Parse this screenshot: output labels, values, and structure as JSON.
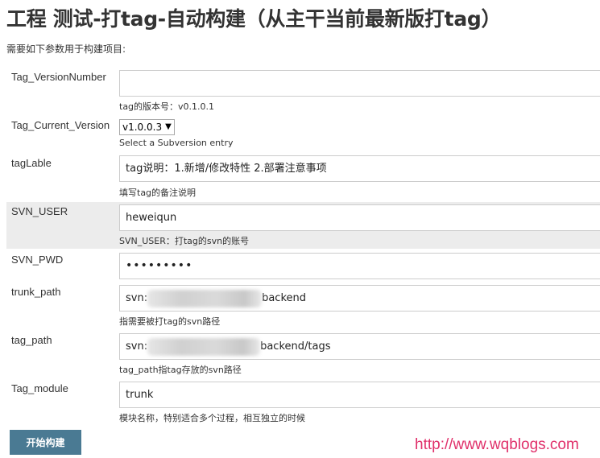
{
  "page": {
    "title": "工程 测试-打tag-自动构建（从主干当前最新版打tag）",
    "intro": "需要如下参数用于构建项目:",
    "build_button": "开始构建",
    "watermark": "http://www.wqblogs.com"
  },
  "params": [
    {
      "label": "Tag_VersionNumber",
      "value": "",
      "help": "tag的版本号：v0.1.0.1"
    },
    {
      "label": "Tag_Current_Version",
      "selected": "v1.0.0.3",
      "help": "Select a Subversion entry"
    },
    {
      "label": "tagLable",
      "value": "tag说明：1.新增/修改特性  2.部署注意事项",
      "help": "填写tag的备注说明"
    },
    {
      "label": "SVN_USER",
      "value": "heweiqun",
      "help": "SVN_USER：打tag的svn的账号"
    },
    {
      "label": "SVN_PWD",
      "value": "•••••••••",
      "help": ""
    },
    {
      "label": "trunk_path",
      "value_prefix": "svn:",
      "value_suffix": "backend",
      "help": "指需要被打tag的svn路径"
    },
    {
      "label": "tag_path",
      "value_prefix": "svn:",
      "value_suffix": "backend/tags",
      "help": "tag_path指tag存放的svn路径"
    },
    {
      "label": "Tag_module",
      "value": "trunk",
      "help": "模块名称，特别适合多个过程，相互独立的时候"
    }
  ],
  "colors": {
    "button_bg": "#4a7a93",
    "highlight_row": "#ececec",
    "watermark": "#e0306a"
  }
}
